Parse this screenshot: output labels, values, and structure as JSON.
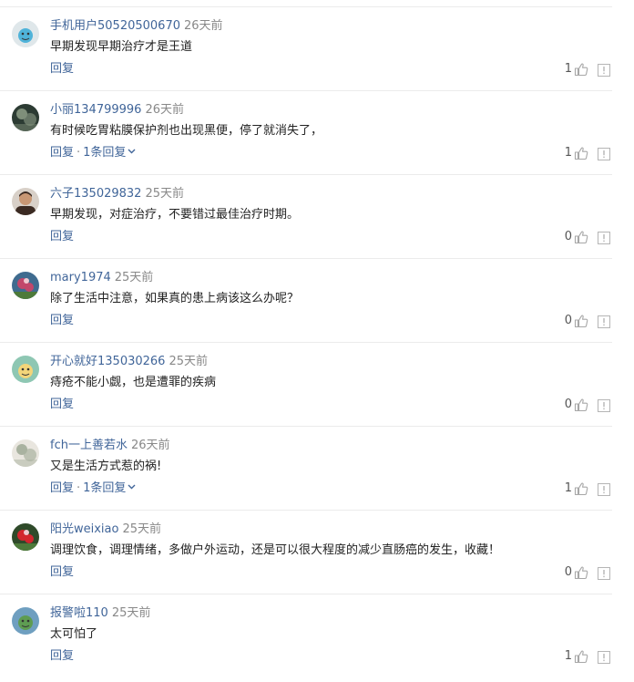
{
  "comments": [
    {
      "username": "手机用户50520500670",
      "time": "26天前",
      "content": "早期发现早期治疗才是王道",
      "reply_label": "回复",
      "reply_count": "",
      "likes": "1",
      "avatar_icon": "avatar-cartoon-icon",
      "avatar_colors": [
        "#dfe7ea",
        "#4fb3d9"
      ]
    },
    {
      "username": "小丽134799996",
      "time": "26天前",
      "content": "有时候吃胃粘膜保护剂也出现黑便，停了就消失了，",
      "reply_label": "回复",
      "reply_count": "1条回复",
      "likes": "1",
      "avatar_icon": "avatar-photo-icon",
      "avatar_colors": [
        "#2c3b33",
        "#7f8f7a"
      ]
    },
    {
      "username": "六子135029832",
      "time": "25天前",
      "content": "早期发现，对症治疗，不要错过最佳治疗时期。",
      "reply_label": "回复",
      "reply_count": "",
      "likes": "0",
      "avatar_icon": "avatar-person-icon",
      "avatar_colors": [
        "#3b2a22",
        "#c89774"
      ]
    },
    {
      "username": "mary1974",
      "time": "25天前",
      "content": "除了生活中注意，如果真的患上病该这么办呢？",
      "reply_label": "回复",
      "reply_count": "",
      "likes": "0",
      "avatar_icon": "avatar-flower-icon",
      "avatar_colors": [
        "#3f6b8f",
        "#c2476b"
      ]
    },
    {
      "username": "开心就好135030266",
      "time": "25天前",
      "content": "痔疮不能小觑，也是遭罪的疾病",
      "reply_label": "回复",
      "reply_count": "",
      "likes": "0",
      "avatar_icon": "avatar-cartoon-icon",
      "avatar_colors": [
        "#8ec7b3",
        "#f3d57a"
      ]
    },
    {
      "username": "fch一上善若水",
      "time": "26天前",
      "content": "又是生活方式惹的祸!",
      "reply_label": "回复",
      "reply_count": "1条回复",
      "likes": "1",
      "avatar_icon": "avatar-photo-icon",
      "avatar_colors": [
        "#e9e6df",
        "#a9b2a0"
      ]
    },
    {
      "username": "阳光weixiao",
      "time": "25天前",
      "content": "调理饮食，调理情绪，多做户外运动，还是可以很大程度的减少直肠癌的发生，收藏！",
      "reply_label": "回复",
      "reply_count": "",
      "likes": "0",
      "avatar_icon": "avatar-flower-icon",
      "avatar_colors": [
        "#2f4a2a",
        "#d2262e"
      ]
    },
    {
      "username": "报警啦110",
      "time": "25天前",
      "content": "太可怕了",
      "reply_label": "回复",
      "reply_count": "",
      "likes": "1",
      "avatar_icon": "avatar-cartoon-icon",
      "avatar_colors": [
        "#6f9fc0",
        "#5e9c52"
      ]
    }
  ],
  "separator": "·"
}
